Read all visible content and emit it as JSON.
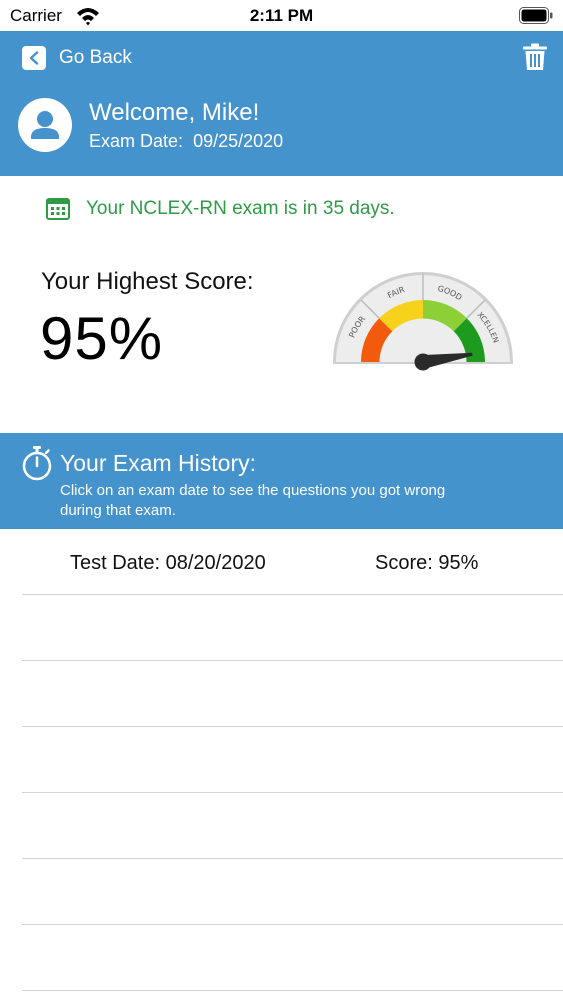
{
  "status_bar": {
    "carrier": "Carrier",
    "time": "2:11 PM"
  },
  "header": {
    "back_label": "Go Back",
    "welcome": "Welcome, Mike!",
    "exam_date_label": "Exam Date:",
    "exam_date_value": "09/25/2020"
  },
  "countdown": {
    "text": "Your NCLEX-RN exam is in 35 days."
  },
  "score": {
    "label": "Your Highest Score:",
    "value": "95%",
    "gauge": {
      "labels": [
        "POOR",
        "FAIR",
        "GOOD",
        "EXCELLENT"
      ],
      "colors": [
        "#f25a0d",
        "#f7d21c",
        "#8ccf36",
        "#1e9a1e"
      ],
      "needle_percent": 95
    }
  },
  "history": {
    "title": "Your Exam History:",
    "subtitle": "Click on an exam date to see the questions you got wrong during that exam.",
    "rows": [
      {
        "date": "Test Date: 08/20/2020",
        "score": "Score: 95%"
      },
      {
        "date": "",
        "score": ""
      },
      {
        "date": "",
        "score": ""
      },
      {
        "date": "",
        "score": ""
      },
      {
        "date": "",
        "score": ""
      },
      {
        "date": "",
        "score": ""
      },
      {
        "date": "",
        "score": ""
      }
    ]
  },
  "colors": {
    "header_blue": "#4493cd",
    "success_green": "#2f9b47"
  },
  "icons": [
    "wifi-icon",
    "battery-icon",
    "back-chevron-icon",
    "trash-icon",
    "avatar-icon",
    "calendar-icon",
    "stopwatch-icon"
  ]
}
